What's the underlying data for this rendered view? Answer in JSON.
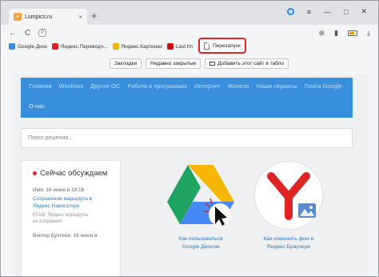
{
  "browser": {
    "tab_title": "Lumpics.ru",
    "tab_close": "×",
    "new_tab": "+",
    "window_controls": [
      "≡",
      "—",
      "□",
      "✕"
    ],
    "nav": {
      "back": "←",
      "reload": "C",
      "protect": "P"
    },
    "nav_right": [
      "⊗",
      "▮"
    ]
  },
  "bookmarks": [
    {
      "label": "Google Диск",
      "color": "#3b8ee8"
    },
    {
      "label": "Яндекс.Переводч...",
      "color": "#e02424"
    },
    {
      "label": "Яндекс.Картинки",
      "color": "#f2b400"
    },
    {
      "label": "Last.fm",
      "color": "#c11"
    }
  ],
  "highlighted_bookmark": "Перезапуск",
  "actions": {
    "bookmarks": "Закладки",
    "recently_closed": "Недавно закрытые",
    "add_to_board": "Добавить этот сайт в табло"
  },
  "site": {
    "nav_row1": [
      "Главная",
      "Windows",
      "Другие ОС",
      "Работа в программах",
      "Интернет",
      "Железо",
      "Наши сервисы",
      "Поиск Google"
    ],
    "nav_row2": "О нас",
    "search_placeholder": "Поиск решения...",
    "sidebar": {
      "title": "Сейчас обсуждаем",
      "meta1": "Имя: 16 июня в 18:16",
      "link1_line1": "Сохранение маршрута в",
      "link1_line2": "Яндекс Навигаторе",
      "excerpt_line1": "КГАМ: Яндекс маршруты",
      "excerpt_line2": "не сохраняет",
      "meta2": "Виктор Бухтеев: 16 июня в"
    },
    "cards": [
      {
        "line1": "Как пользоваться",
        "line2": "Google Диском"
      },
      {
        "line1": "Как изменить фон в",
        "line2": "Яндекс Браузере"
      }
    ]
  }
}
